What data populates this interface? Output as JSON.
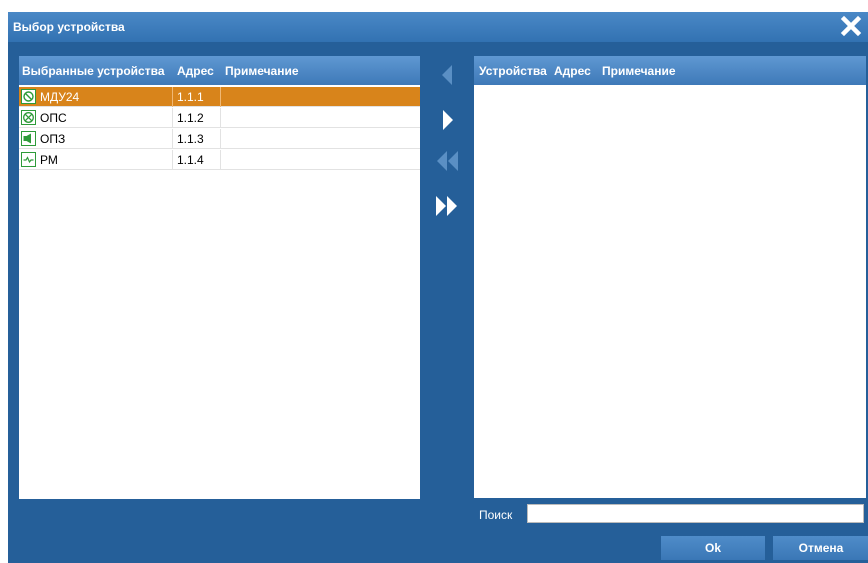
{
  "dialog": {
    "title": "Выбор устройства"
  },
  "selected_panel": {
    "headers": [
      "Выбранные устройства",
      "Адрес",
      "Примечание"
    ],
    "rows": [
      {
        "name": "МДУ24",
        "address": "1.1.1",
        "note": "",
        "icon": "mdu-device-icon",
        "selected": true
      },
      {
        "name": "ОПС",
        "address": "1.1.2",
        "note": "",
        "icon": "ops-device-icon",
        "selected": false
      },
      {
        "name": "ОПЗ",
        "address": "1.1.3",
        "note": "",
        "icon": "opz-device-icon",
        "selected": false
      },
      {
        "name": "РМ",
        "address": "1.1.4",
        "note": "",
        "icon": "rm-device-icon",
        "selected": false
      }
    ]
  },
  "available_panel": {
    "headers": [
      "Устройства",
      "Адрес",
      "Примечание"
    ],
    "rows": []
  },
  "search": {
    "label": "Поиск",
    "value": ""
  },
  "buttons": {
    "ok": "Ok",
    "cancel": "Отмена"
  },
  "colors": {
    "dialog_bg": "#255f99",
    "selected_row": "#d8841b",
    "icon_green": "#2d9b39"
  }
}
